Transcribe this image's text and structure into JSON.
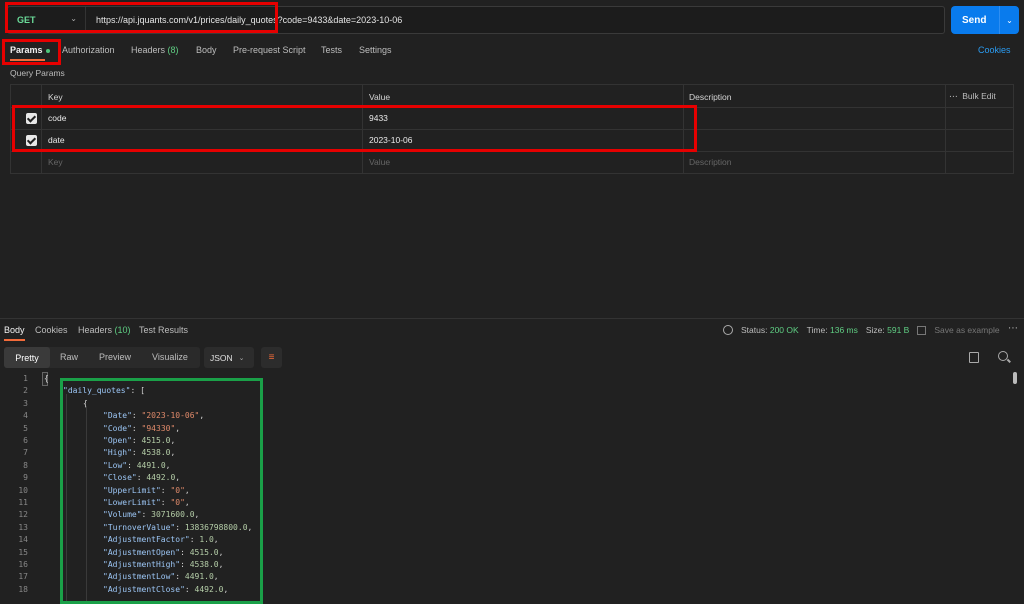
{
  "request": {
    "method": "GET",
    "url": "https://api.jquants.com/v1/prices/daily_quotes?code=9433&date=2023-10-06",
    "send_label": "Send"
  },
  "request_tabs": {
    "params": "Params",
    "authorization": "Authorization",
    "headers": "Headers",
    "headers_count": "(8)",
    "body": "Body",
    "pre_request": "Pre-request Script",
    "tests": "Tests",
    "settings": "Settings",
    "cookies": "Cookies"
  },
  "query_params": {
    "label": "Query Params",
    "headers": {
      "key": "Key",
      "value": "Value",
      "description": "Description",
      "bulk_edit": "Bulk Edit"
    },
    "rows": [
      {
        "key": "code",
        "value": "9433",
        "checked": true
      },
      {
        "key": "date",
        "value": "2023-10-06",
        "checked": true
      }
    ],
    "placeholder": {
      "key": "Key",
      "value": "Value",
      "description": "Description"
    }
  },
  "response": {
    "tabs": {
      "body": "Body",
      "cookies": "Cookies",
      "headers": "Headers",
      "headers_count": "(10)",
      "test_results": "Test Results"
    },
    "status_label": "Status:",
    "status_value": "200 OK",
    "time_label": "Time:",
    "time_value": "136 ms",
    "size_label": "Size:",
    "size_value": "591 B",
    "save_example": "Save as example",
    "views": {
      "pretty": "Pretty",
      "raw": "Raw",
      "preview": "Preview",
      "visualize": "Visualize"
    },
    "format": "JSON"
  },
  "code": {
    "line_numbers": [
      "1",
      "2",
      "3",
      "4",
      "5",
      "6",
      "7",
      "8",
      "9",
      "10",
      "11",
      "12",
      "13",
      "14",
      "15",
      "16",
      "17",
      "18"
    ],
    "open_brace": "{",
    "daily_quotes_key": "\"daily_quotes\"",
    "daily_quotes_rest": ": [",
    "item_open": "{",
    "fields": [
      {
        "key": "\"Date\"",
        "value": "\"2023-10-06\"",
        "type": "s"
      },
      {
        "key": "\"Code\"",
        "value": "\"94330\"",
        "type": "s"
      },
      {
        "key": "\"Open\"",
        "value": "4515.0",
        "type": "n"
      },
      {
        "key": "\"High\"",
        "value": "4538.0",
        "type": "n"
      },
      {
        "key": "\"Low\"",
        "value": "4491.0",
        "type": "n"
      },
      {
        "key": "\"Close\"",
        "value": "4492.0",
        "type": "n"
      },
      {
        "key": "\"UpperLimit\"",
        "value": "\"0\"",
        "type": "s"
      },
      {
        "key": "\"LowerLimit\"",
        "value": "\"0\"",
        "type": "s"
      },
      {
        "key": "\"Volume\"",
        "value": "3071600.0",
        "type": "n"
      },
      {
        "key": "\"TurnoverValue\"",
        "value": "13836798800.0",
        "type": "n"
      },
      {
        "key": "\"AdjustmentFactor\"",
        "value": "1.0",
        "type": "n"
      },
      {
        "key": "\"AdjustmentOpen\"",
        "value": "4515.0",
        "type": "n"
      },
      {
        "key": "\"AdjustmentHigh\"",
        "value": "4538.0",
        "type": "n"
      },
      {
        "key": "\"AdjustmentLow\"",
        "value": "4491.0",
        "type": "n"
      },
      {
        "key": "\"AdjustmentClose\"",
        "value": "4492.0",
        "type": "n"
      }
    ]
  }
}
